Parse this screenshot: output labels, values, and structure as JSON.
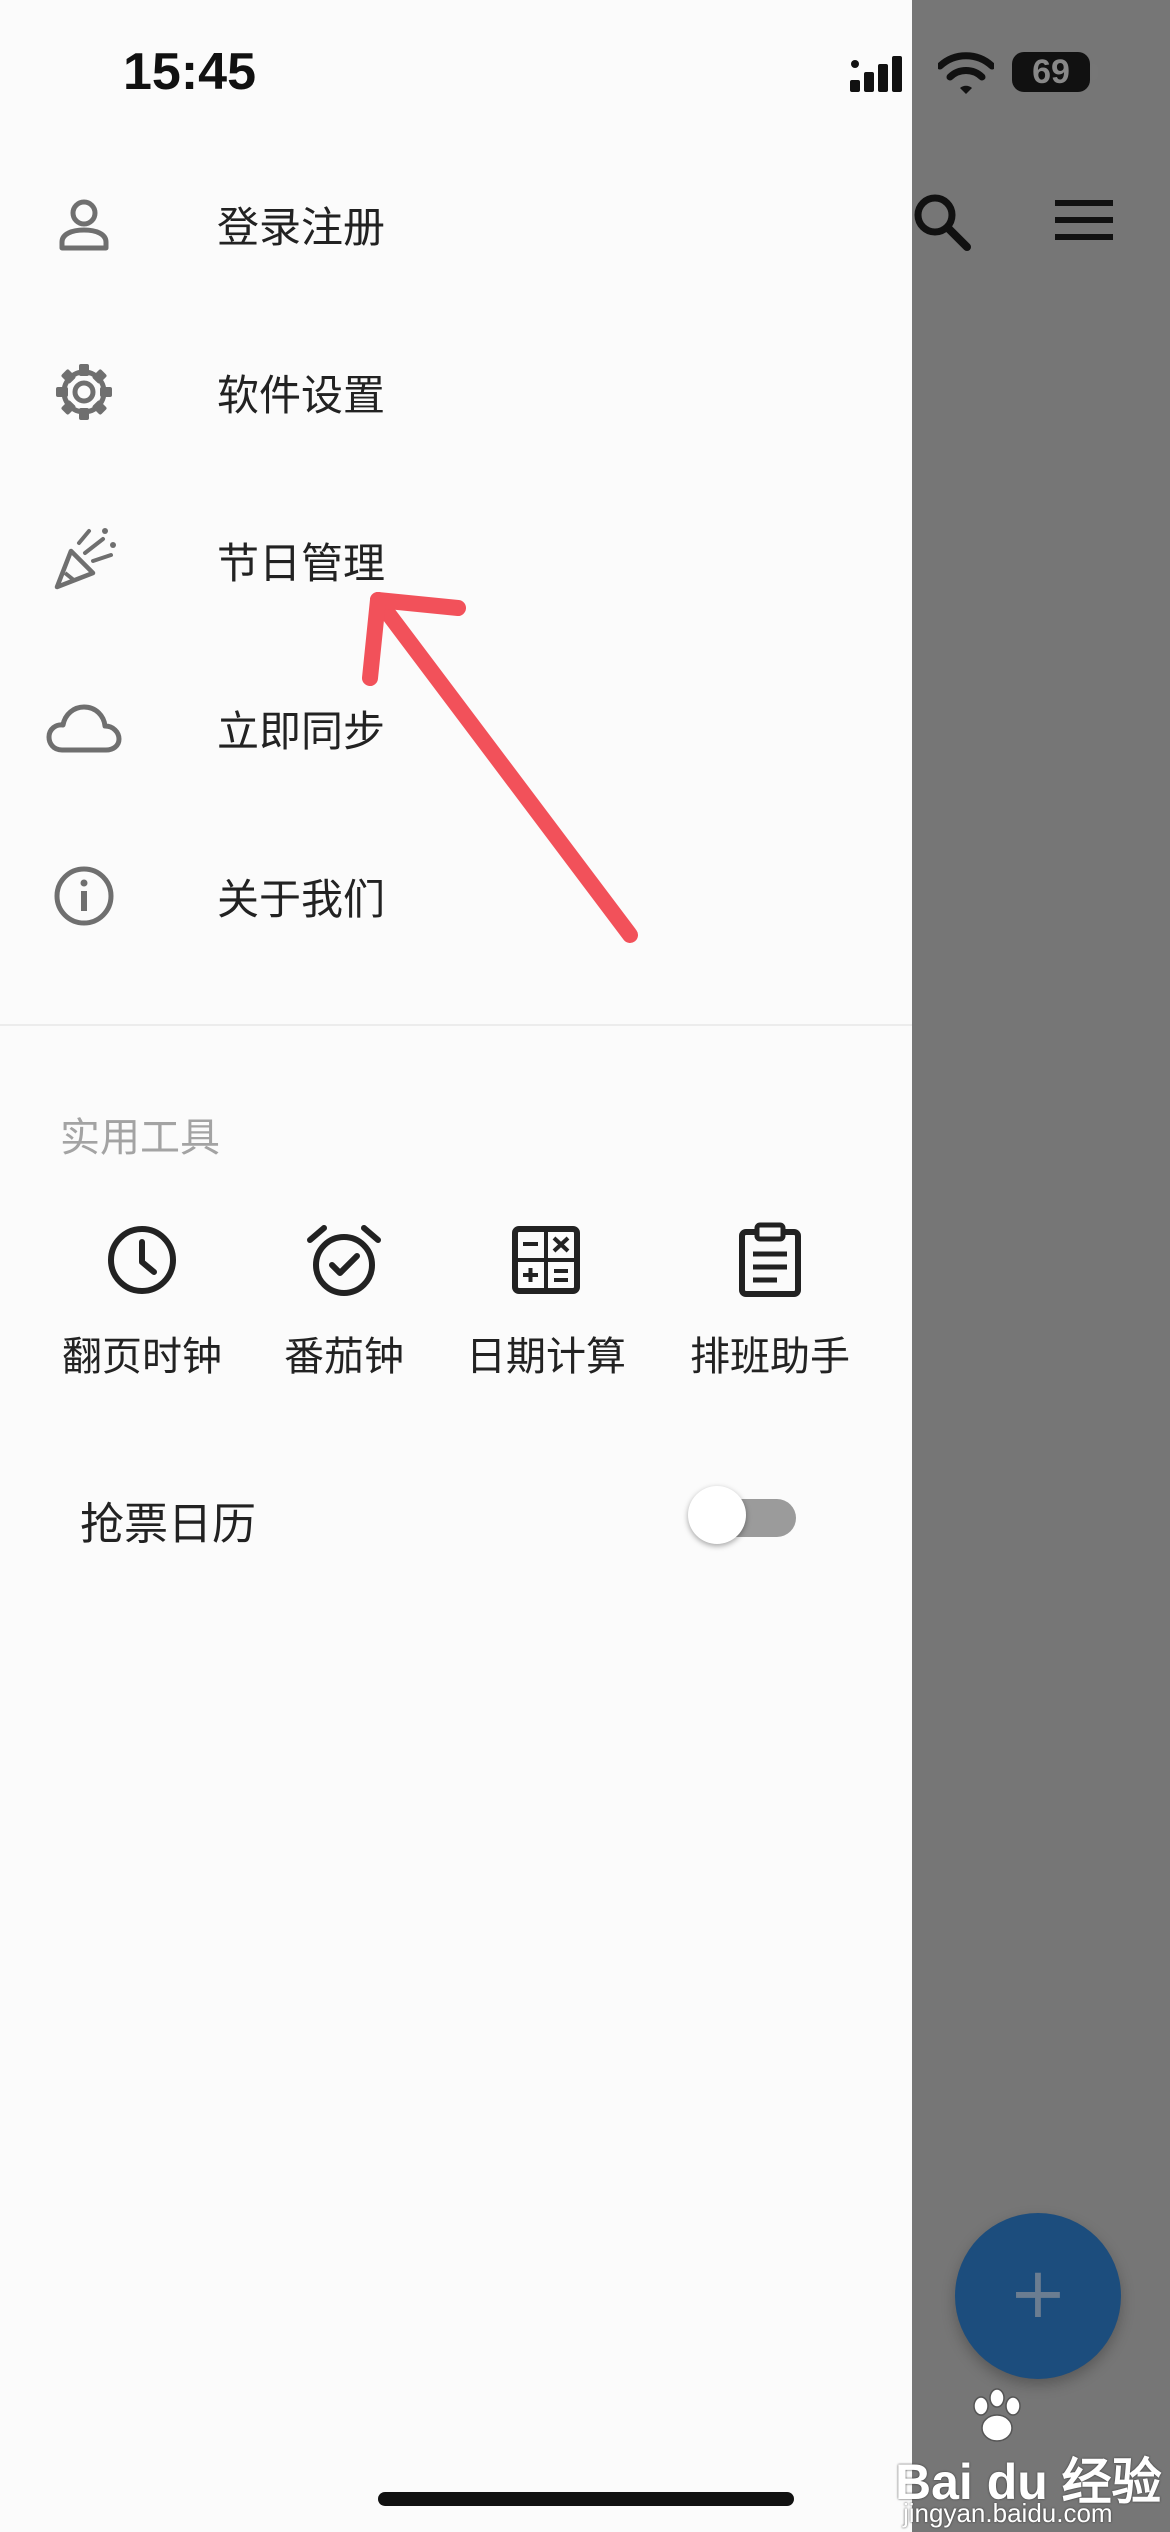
{
  "status_bar": {
    "time": "15:45",
    "battery": "69"
  },
  "menu": {
    "items": [
      {
        "label": "登录注册",
        "icon": "person-icon"
      },
      {
        "label": "软件设置",
        "icon": "gear-icon"
      },
      {
        "label": "节日管理",
        "icon": "party-popper-icon"
      },
      {
        "label": "立即同步",
        "icon": "cloud-icon"
      },
      {
        "label": "关于我们",
        "icon": "info-icon"
      }
    ]
  },
  "tools": {
    "title": "实用工具",
    "items": [
      {
        "label": "翻页时钟",
        "icon": "clock-icon"
      },
      {
        "label": "番茄钟",
        "icon": "alarm-check-icon"
      },
      {
        "label": "日期计算",
        "icon": "calculator-icon"
      },
      {
        "label": "排班助手",
        "icon": "clipboard-icon"
      }
    ]
  },
  "settings": {
    "ticket_calendar": {
      "label": "抢票日历",
      "enabled": false
    }
  },
  "fab": {
    "label": "+"
  },
  "watermark": {
    "brand": "Bai du 经验",
    "url": "jingyan.baidu.com"
  },
  "colors": {
    "annotation_arrow": "#f2515a",
    "fab": "#1c4d7d",
    "overlay": "#767676"
  }
}
